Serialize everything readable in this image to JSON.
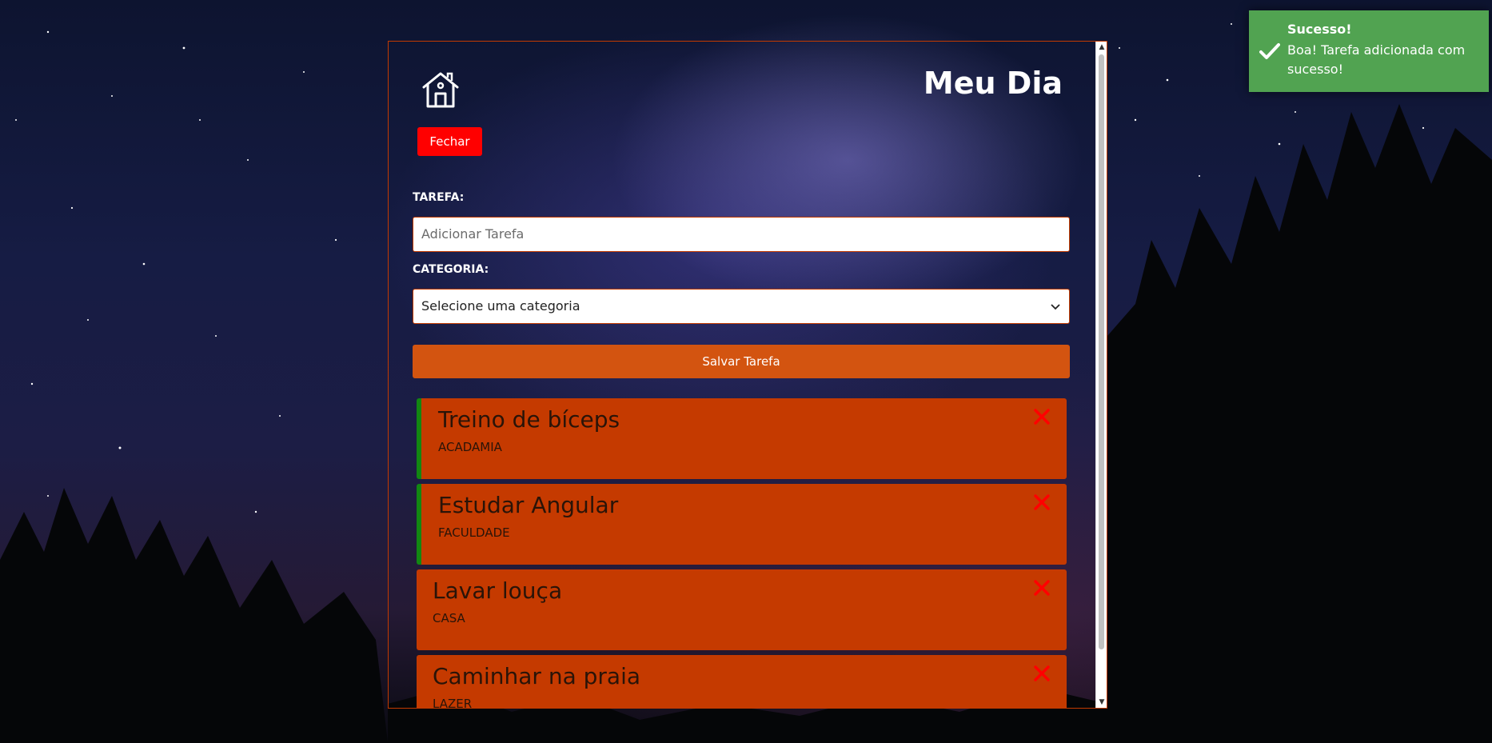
{
  "header": {
    "title": "Meu Dia",
    "close_label": "Fechar",
    "home_icon": "home-icon"
  },
  "form": {
    "task_label": "TAREFA:",
    "task_placeholder": "Adicionar Tarefa",
    "task_value": "",
    "category_label": "CATEGORIA:",
    "category_selected": "Selecione uma categoria",
    "save_label": "Salvar Tarefa"
  },
  "tasks": [
    {
      "title": "Treino de bíceps",
      "category": "ACADAMIA",
      "done": true
    },
    {
      "title": "Estudar Angular",
      "category": "FACULDADE",
      "done": true
    },
    {
      "title": "Lavar louça",
      "category": "CASA",
      "done": false
    },
    {
      "title": "Caminhar na praia",
      "category": "LAZER",
      "done": false
    }
  ],
  "toast": {
    "title": "Sucesso!",
    "message": "Boa! Tarefa adicionada com sucesso!"
  },
  "colors": {
    "task_bg": "#c53a00",
    "done_marker": "#128712",
    "save_button": "#d35410",
    "close_button": "#ff0000",
    "toast_bg": "#51a351",
    "delete_icon": "#ff0000"
  }
}
